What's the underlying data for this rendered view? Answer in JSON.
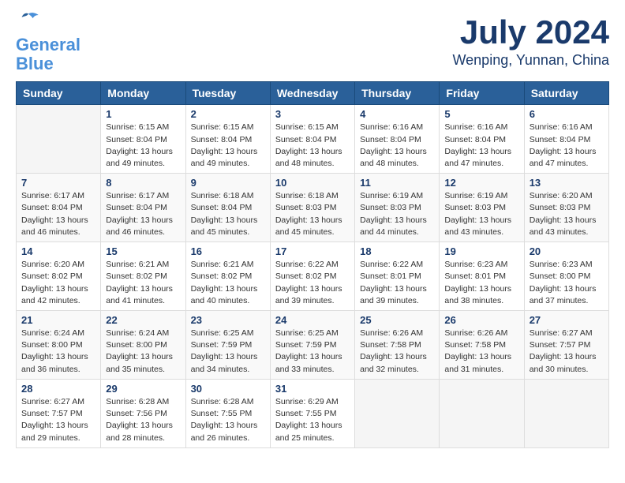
{
  "logo": {
    "line1": "General",
    "line2": "Blue"
  },
  "title": {
    "month": "July 2024",
    "location": "Wenping, Yunnan, China"
  },
  "headers": [
    "Sunday",
    "Monday",
    "Tuesday",
    "Wednesday",
    "Thursday",
    "Friday",
    "Saturday"
  ],
  "weeks": [
    [
      {
        "day": "",
        "info": ""
      },
      {
        "day": "1",
        "info": "Sunrise: 6:15 AM\nSunset: 8:04 PM\nDaylight: 13 hours\nand 49 minutes."
      },
      {
        "day": "2",
        "info": "Sunrise: 6:15 AM\nSunset: 8:04 PM\nDaylight: 13 hours\nand 49 minutes."
      },
      {
        "day": "3",
        "info": "Sunrise: 6:15 AM\nSunset: 8:04 PM\nDaylight: 13 hours\nand 48 minutes."
      },
      {
        "day": "4",
        "info": "Sunrise: 6:16 AM\nSunset: 8:04 PM\nDaylight: 13 hours\nand 48 minutes."
      },
      {
        "day": "5",
        "info": "Sunrise: 6:16 AM\nSunset: 8:04 PM\nDaylight: 13 hours\nand 47 minutes."
      },
      {
        "day": "6",
        "info": "Sunrise: 6:16 AM\nSunset: 8:04 PM\nDaylight: 13 hours\nand 47 minutes."
      }
    ],
    [
      {
        "day": "7",
        "info": "Sunrise: 6:17 AM\nSunset: 8:04 PM\nDaylight: 13 hours\nand 46 minutes."
      },
      {
        "day": "8",
        "info": "Sunrise: 6:17 AM\nSunset: 8:04 PM\nDaylight: 13 hours\nand 46 minutes."
      },
      {
        "day": "9",
        "info": "Sunrise: 6:18 AM\nSunset: 8:04 PM\nDaylight: 13 hours\nand 45 minutes."
      },
      {
        "day": "10",
        "info": "Sunrise: 6:18 AM\nSunset: 8:03 PM\nDaylight: 13 hours\nand 45 minutes."
      },
      {
        "day": "11",
        "info": "Sunrise: 6:19 AM\nSunset: 8:03 PM\nDaylight: 13 hours\nand 44 minutes."
      },
      {
        "day": "12",
        "info": "Sunrise: 6:19 AM\nSunset: 8:03 PM\nDaylight: 13 hours\nand 43 minutes."
      },
      {
        "day": "13",
        "info": "Sunrise: 6:20 AM\nSunset: 8:03 PM\nDaylight: 13 hours\nand 43 minutes."
      }
    ],
    [
      {
        "day": "14",
        "info": "Sunrise: 6:20 AM\nSunset: 8:02 PM\nDaylight: 13 hours\nand 42 minutes."
      },
      {
        "day": "15",
        "info": "Sunrise: 6:21 AM\nSunset: 8:02 PM\nDaylight: 13 hours\nand 41 minutes."
      },
      {
        "day": "16",
        "info": "Sunrise: 6:21 AM\nSunset: 8:02 PM\nDaylight: 13 hours\nand 40 minutes."
      },
      {
        "day": "17",
        "info": "Sunrise: 6:22 AM\nSunset: 8:02 PM\nDaylight: 13 hours\nand 39 minutes."
      },
      {
        "day": "18",
        "info": "Sunrise: 6:22 AM\nSunset: 8:01 PM\nDaylight: 13 hours\nand 39 minutes."
      },
      {
        "day": "19",
        "info": "Sunrise: 6:23 AM\nSunset: 8:01 PM\nDaylight: 13 hours\nand 38 minutes."
      },
      {
        "day": "20",
        "info": "Sunrise: 6:23 AM\nSunset: 8:00 PM\nDaylight: 13 hours\nand 37 minutes."
      }
    ],
    [
      {
        "day": "21",
        "info": "Sunrise: 6:24 AM\nSunset: 8:00 PM\nDaylight: 13 hours\nand 36 minutes."
      },
      {
        "day": "22",
        "info": "Sunrise: 6:24 AM\nSunset: 8:00 PM\nDaylight: 13 hours\nand 35 minutes."
      },
      {
        "day": "23",
        "info": "Sunrise: 6:25 AM\nSunset: 7:59 PM\nDaylight: 13 hours\nand 34 minutes."
      },
      {
        "day": "24",
        "info": "Sunrise: 6:25 AM\nSunset: 7:59 PM\nDaylight: 13 hours\nand 33 minutes."
      },
      {
        "day": "25",
        "info": "Sunrise: 6:26 AM\nSunset: 7:58 PM\nDaylight: 13 hours\nand 32 minutes."
      },
      {
        "day": "26",
        "info": "Sunrise: 6:26 AM\nSunset: 7:58 PM\nDaylight: 13 hours\nand 31 minutes."
      },
      {
        "day": "27",
        "info": "Sunrise: 6:27 AM\nSunset: 7:57 PM\nDaylight: 13 hours\nand 30 minutes."
      }
    ],
    [
      {
        "day": "28",
        "info": "Sunrise: 6:27 AM\nSunset: 7:57 PM\nDaylight: 13 hours\nand 29 minutes."
      },
      {
        "day": "29",
        "info": "Sunrise: 6:28 AM\nSunset: 7:56 PM\nDaylight: 13 hours\nand 28 minutes."
      },
      {
        "day": "30",
        "info": "Sunrise: 6:28 AM\nSunset: 7:55 PM\nDaylight: 13 hours\nand 26 minutes."
      },
      {
        "day": "31",
        "info": "Sunrise: 6:29 AM\nSunset: 7:55 PM\nDaylight: 13 hours\nand 25 minutes."
      },
      {
        "day": "",
        "info": ""
      },
      {
        "day": "",
        "info": ""
      },
      {
        "day": "",
        "info": ""
      }
    ]
  ]
}
